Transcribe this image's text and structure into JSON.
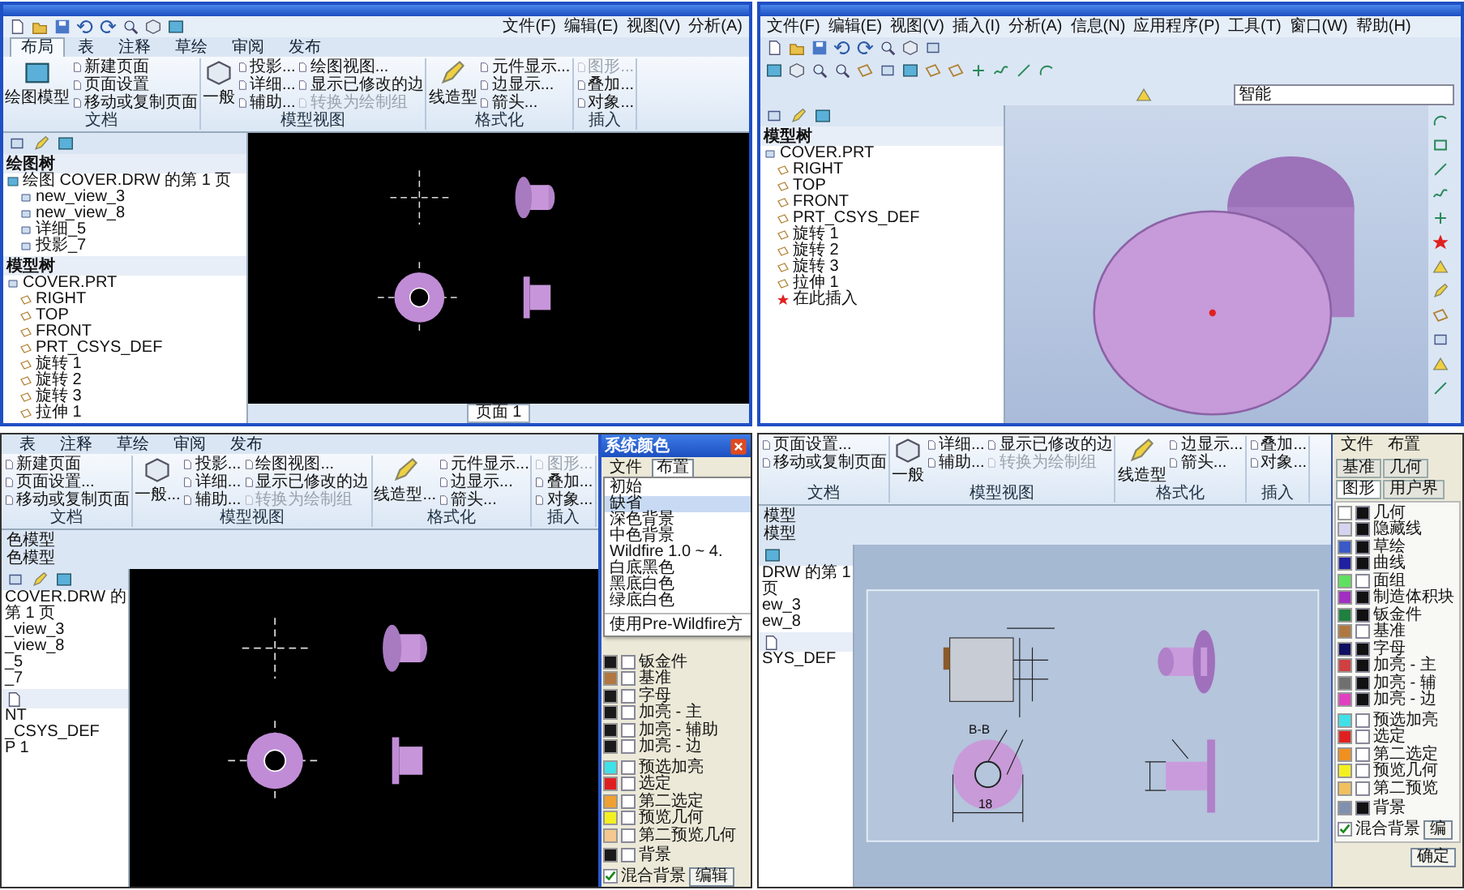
{
  "top_left": {
    "menu": [
      "文件(F)",
      "编辑(E)",
      "视图(V)",
      "分析(A)"
    ],
    "tabs": [
      {
        "label": "布局",
        "selected": true
      },
      {
        "label": "表",
        "selected": false
      },
      {
        "label": "注释",
        "selected": false
      },
      {
        "label": "草绘",
        "selected": false
      },
      {
        "label": "审阅",
        "selected": false
      },
      {
        "label": "发布",
        "selected": false
      }
    ],
    "ribbon": [
      {
        "title": "文档",
        "large": "绘图模型",
        "items": [
          {
            "label": "新建页面",
            "disabled": false
          },
          {
            "label": "页面设置",
            "disabled": false
          },
          {
            "label": "移动或复制页面",
            "disabled": false
          }
        ]
      },
      {
        "title": "模型视图",
        "large": "一般",
        "items": [
          {
            "label": "投影...",
            "disabled": false
          },
          {
            "label": "详细...",
            "disabled": false
          },
          {
            "label": "辅助...",
            "disabled": false
          },
          {
            "label": "绘图视图...",
            "disabled": false
          },
          {
            "label": "显示已修改的边",
            "disabled": false
          },
          {
            "label": "转换为绘制组",
            "disabled": true
          }
        ]
      },
      {
        "title": "格式化",
        "large": "线造型",
        "items": [
          {
            "label": "元件显示...",
            "disabled": false
          },
          {
            "label": "边显示...",
            "disabled": false
          },
          {
            "label": "箭头...",
            "disabled": false
          }
        ]
      },
      {
        "title": "插入",
        "items": [
          {
            "label": "图形...",
            "disabled": true
          },
          {
            "label": "叠加...",
            "disabled": false
          },
          {
            "label": "对象...",
            "disabled": false
          }
        ]
      }
    ],
    "drawing_tree": {
      "title": "绘图树",
      "items": [
        {
          "label": "绘图 COVER.DRW 的第 1 页",
          "children": [
            {
              "label": "new_view_3"
            },
            {
              "label": "new_view_8"
            },
            {
              "label": "详细_5"
            },
            {
              "label": "投影_7"
            }
          ]
        }
      ]
    },
    "model_tree": {
      "title": "模型树",
      "items": [
        {
          "label": "COVER.PRT",
          "children": [
            {
              "label": "RIGHT"
            },
            {
              "label": "TOP"
            },
            {
              "label": "FRONT"
            },
            {
              "label": "PRT_CSYS_DEF"
            },
            {
              "label": "旋转 1"
            },
            {
              "label": "旋转 2"
            },
            {
              "label": "旋转 3"
            },
            {
              "label": "拉伸 1"
            }
          ]
        }
      ]
    },
    "page_tab": "页面 1"
  },
  "top_right": {
    "menu": [
      "文件(F)",
      "编辑(E)",
      "视图(V)",
      "插入(I)",
      "分析(A)",
      "信息(N)",
      "应用程序(P)",
      "工具(T)",
      "窗口(W)",
      "帮助(H)"
    ],
    "search": {
      "value": "智能"
    },
    "model_tree": {
      "title": "模型树",
      "items": [
        {
          "label": "COVER.PRT",
          "children": [
            {
              "label": "RIGHT"
            },
            {
              "label": "TOP"
            },
            {
              "label": "FRONT"
            },
            {
              "label": "PRT_CSYS_DEF"
            },
            {
              "label": "旋转 1"
            },
            {
              "label": "旋转 2"
            },
            {
              "label": "旋转 3"
            },
            {
              "label": "拉伸 1"
            }
          ]
        }
      ]
    },
    "insert_here": "在此插入"
  },
  "bottom_left": {
    "tabs": [
      "表",
      "注释",
      "草绘",
      "审阅",
      "发布"
    ],
    "ribbon": [
      {
        "title": "文档",
        "items": [
          {
            "label": "新建页面",
            "disabled": false
          },
          {
            "label": "页面设置...",
            "disabled": false
          },
          {
            "label": "移动或复制页面",
            "disabled": false
          }
        ]
      },
      {
        "title": "模型视图",
        "large": "一般...",
        "items": [
          {
            "label": "投影...",
            "disabled": false
          },
          {
            "label": "详细...",
            "disabled": false
          },
          {
            "label": "辅助...",
            "disabled": false
          },
          {
            "label": "绘图视图...",
            "disabled": false
          },
          {
            "label": "显示已修改的边",
            "disabled": false
          },
          {
            "label": "转换为绘制组",
            "disabled": true
          }
        ]
      },
      {
        "title": "格式化",
        "large": "线造型...",
        "items": [
          {
            "label": "元件显示...",
            "disabled": false
          },
          {
            "label": "边显示...",
            "disabled": false
          },
          {
            "label": "箭头...",
            "disabled": false
          }
        ]
      },
      {
        "title": "插入",
        "items": [
          {
            "label": "图形...",
            "disabled": true
          },
          {
            "label": "叠加...",
            "disabled": false
          },
          {
            "label": "对象...",
            "disabled": false
          }
        ]
      }
    ],
    "messages": [
      "色模型",
      "色模型"
    ],
    "drawing_tree": {
      "items": [
        {
          "label": "COVER.DRW 的第 1 页",
          "children": [
            {
              "label": "_view_3"
            },
            {
              "label": "_view_8"
            },
            {
              "label": "_5"
            },
            {
              "label": "_7"
            }
          ]
        }
      ]
    },
    "model_tree": {
      "items": [
        {
          "label": "NT"
        },
        {
          "label": "_CSYS_DEF"
        },
        {
          "label": "P 1"
        }
      ]
    },
    "dialog": {
      "title": "系统颜色",
      "menu": [
        {
          "label": "文件",
          "selected": false
        },
        {
          "label": "布置",
          "selected": true
        }
      ],
      "dropdown": [
        {
          "label": "初始",
          "selected": false
        },
        {
          "label": "缺省",
          "selected": true
        },
        {
          "label": "深色背景",
          "selected": false
        },
        {
          "label": "中色背景",
          "selected": false
        },
        {
          "label": "Wildfire 1.0 ~ 4.",
          "selected": false
        },
        {
          "label": "白底黑色",
          "selected": false
        },
        {
          "label": "黑底白色",
          "selected": false
        },
        {
          "label": "绿底白色",
          "selected": false
        },
        {
          "label": "使用Pre-Wildfire方",
          "selected": false
        }
      ],
      "rows": [
        {
          "label": "钣金件",
          "color": "#1a1a1a",
          "checked": false
        },
        {
          "label": "基准",
          "color": "#b07840",
          "checked": false
        },
        {
          "label": "字母",
          "color": "#1a1a1a",
          "checked": false
        },
        {
          "label": "加亮 - 主",
          "color": "#1a1a1a",
          "checked": false
        },
        {
          "label": "加亮 - 辅助",
          "color": "#1a1a1a",
          "checked": false
        },
        {
          "label": "加亮 - 边",
          "color": "#1a1a1a",
          "checked": false
        },
        {
          "label": "预选加亮",
          "color": "#40e0e8",
          "checked": false
        },
        {
          "label": "选定",
          "color": "#e02020",
          "checked": false
        },
        {
          "label": "第二选定",
          "color": "#f0a030",
          "checked": false
        },
        {
          "label": "预览几何",
          "color": "#f4f020",
          "checked": false
        },
        {
          "label": "第二预览几何",
          "color": "#f4c890",
          "checked": false
        },
        {
          "label": "背景",
          "color": "#1a1a1a",
          "checked": false
        }
      ],
      "blend": {
        "label": "混合背景",
        "checked": true
      },
      "edit_button": "编辑"
    }
  },
  "bottom_right": {
    "ribbon": [
      {
        "title": "文档",
        "items": [
          {
            "label": "页面设置...",
            "disabled": false
          },
          {
            "label": "移动或复制页面",
            "disabled": false
          }
        ]
      },
      {
        "title": "模型视图",
        "large": "一般",
        "items": [
          {
            "label": "详细...",
            "disabled": false
          },
          {
            "label": "辅助...",
            "disabled": false
          },
          {
            "label": "显示已修改的边",
            "disabled": false
          },
          {
            "label": "转换为绘制组",
            "disabled": true
          }
        ]
      },
      {
        "title": "格式化",
        "large": "线造型",
        "items": [
          {
            "label": "边显示...",
            "disabled": false
          },
          {
            "label": "箭头...",
            "disabled": false
          }
        ]
      },
      {
        "title": "插入",
        "items": [
          {
            "label": "叠加...",
            "disabled": false
          },
          {
            "label": "对象...",
            "disabled": false
          }
        ]
      }
    ],
    "messages": [
      "模型",
      "模型"
    ],
    "drawing_tree": {
      "items": [
        {
          "label": "DRW 的第 1 页",
          "children": [
            {
              "label": "ew_3"
            },
            {
              "label": "ew_8"
            }
          ]
        }
      ]
    },
    "model_tree": {
      "items": [
        {
          "label": "SYS_DEF"
        }
      ]
    },
    "view_label": "B-B",
    "dimension": "18",
    "dialog": {
      "menu": [
        {
          "label": "文件",
          "selected": false
        },
        {
          "label": "布置",
          "selected": false
        }
      ],
      "tabs": [
        {
          "label": "基准",
          "selected": false
        },
        {
          "label": "几何",
          "selected": false
        },
        {
          "label": "图形",
          "selected": true
        },
        {
          "label": "用户界",
          "selected": false
        }
      ],
      "rows": [
        {
          "label": "几何",
          "color": "#ffffff",
          "checked": true
        },
        {
          "label": "隐藏线",
          "color": "#d4d4f0",
          "checked": true
        },
        {
          "label": "草绘",
          "color": "#3a5ac8",
          "checked": true
        },
        {
          "label": "曲线",
          "color": "#2020a0",
          "checked": true
        },
        {
          "label": "面组",
          "color": "#60e060",
          "checked": false
        },
        {
          "label": "制造体积块",
          "color": "#a030c0",
          "checked": true
        },
        {
          "label": "钣金件",
          "color": "#208040",
          "checked": true
        },
        {
          "label": "基准",
          "color": "#b07840",
          "checked": false
        },
        {
          "label": "字母",
          "color": "#101060",
          "checked": true
        },
        {
          "label": "加亮 - 主",
          "color": "#d04040",
          "checked": true
        },
        {
          "label": "加亮 - 辅",
          "color": "#707070",
          "checked": true
        },
        {
          "label": "加亮 - 边",
          "color": "#e040c0",
          "checked": true
        },
        {
          "label": "预选加亮",
          "color": "#40e0e8",
          "checked": false
        },
        {
          "label": "选定",
          "color": "#e02020",
          "checked": false
        },
        {
          "label": "第二选定",
          "color": "#f09020",
          "checked": false
        },
        {
          "label": "预览几何",
          "color": "#f4f020",
          "checked": false
        },
        {
          "label": "第二预览",
          "color": "#f0c060",
          "checked": false
        },
        {
          "label": "背景",
          "color": "#8090b0",
          "checked": true
        }
      ],
      "blend": {
        "label": "混合背景",
        "checked": true
      },
      "edit_button": "编",
      "ok_button": "确定"
    }
  }
}
